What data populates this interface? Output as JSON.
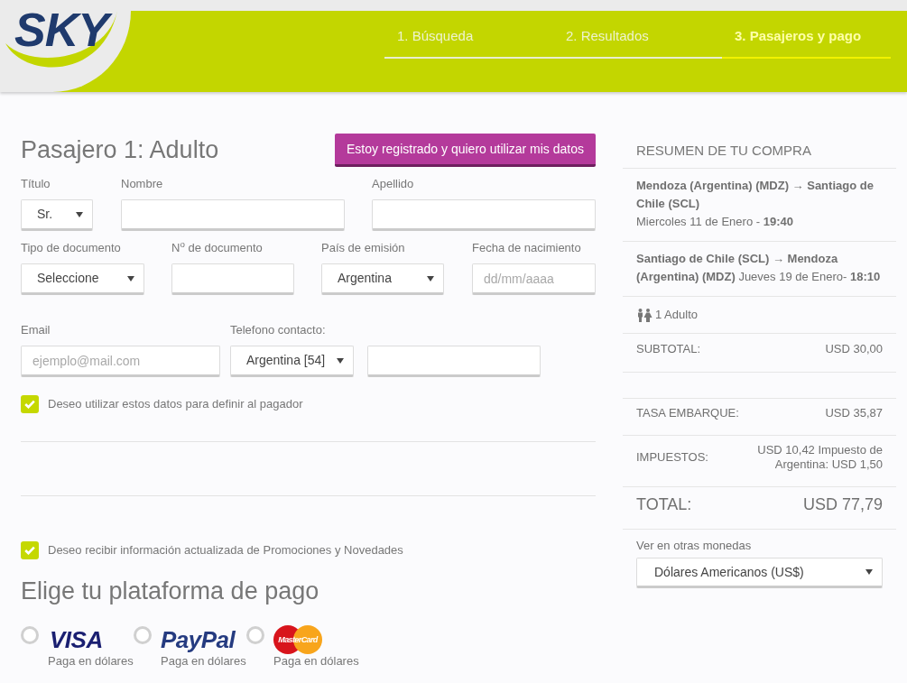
{
  "header": {
    "logo": {
      "text": "SKY"
    },
    "steps": [
      {
        "label": "1. Búsqueda",
        "selected": false
      },
      {
        "label": "2. Resultados",
        "selected": false
      },
      {
        "label": "3. Pasajeros y pago",
        "selected": true
      }
    ]
  },
  "passenger_form": {
    "title": "Pasajero 1: Adulto",
    "registered_button": "Estoy registrado y quiero utilizar mis datos",
    "rows": [
      {
        "fields": [
          {
            "kind": "select",
            "label": "Título",
            "value": "Sr."
          },
          {
            "kind": "input",
            "label": "Nombre"
          },
          {
            "kind": "input",
            "label": "Apellido"
          }
        ]
      },
      {
        "fields": [
          {
            "kind": "select",
            "label": "Tipo de documento",
            "value": "Seleccione"
          },
          {
            "kind": "input",
            "label": "N$^{o}$ de documento"
          },
          {
            "kind": "select",
            "label": "País de emisión",
            "value": "Argentina"
          },
          {
            "kind": "input",
            "label": "Fecha de nacimiento",
            "placeholder": "dd/mm/aaaa"
          }
        ]
      },
      {
        "fields": [
          {
            "kind": "input",
            "label": "Email",
            "placeholder": "ejemplo@mail.com"
          },
          {
            "kind": "select",
            "label": "Telefono contacto:",
            "value": "Argentina [54]"
          },
          {
            "kind": "input"
          }
        ]
      }
    ],
    "payer_checkbox": {
      "label": "Deseo utilizar estos datos para definir al pagador",
      "checked": true
    }
  },
  "newsletter_checkbox": {
    "label": "Deseo recibir información actualizada de Promociones y Novedades",
    "checked": true
  },
  "payment": {
    "title": "Elige tu plataforma de pago",
    "options": [
      {
        "kind": "visa",
        "logo": "VISA",
        "caption": "Paga en dólares",
        "selected": false
      },
      {
        "kind": "paypal",
        "logo": "PayPal",
        "caption": "Paga en dólares",
        "selected": false
      },
      {
        "kind": "mastercard",
        "logo": "MasterCard",
        "caption": "Paga en dólares",
        "selected": false
      }
    ]
  },
  "summary": {
    "title": "RESUMEN DE TU COMPRA",
    "flights": [
      {
        "kind": "stacked",
        "route": "Mendoza (Argentina) (MDZ) → Santiago de Chile (SCL)",
        "schedule": "Miercoles 11 de Enero - **19:40**"
      },
      {
        "kind": "inline",
        "route": "Santiago de Chile (SCL) → Mendoza (Argentina) (MDZ)",
        "schedule": "Jueves 19 de Enero- **18:10**"
      }
    ],
    "passengers": "1 Adulto",
    "charges": [
      {
        "label": "SUBTOTAL:",
        "value": "USD 30,00"
      },
      {
        "label": "TASA EMBARQUE:",
        "value": "USD 35,87"
      },
      {
        "label": "IMPUESTOS:",
        "value": "USD 10,42 Impuesto de Argentina: USD 1,50"
      }
    ],
    "total": {
      "label": "TOTAL:",
      "value": "USD 77,79"
    },
    "currency": {
      "label": "Ver en otras monedas",
      "value": "Dólares Americanos (US$)"
    }
  }
}
